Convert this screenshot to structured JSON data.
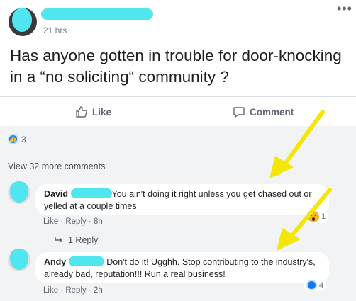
{
  "post": {
    "time": "21 hrs",
    "text": "Has anyone gotten in trouble for door-knocking in a “no soliciting“ community ?",
    "more_label": "•••"
  },
  "actions": {
    "like_label": "Like",
    "comment_label": "Comment"
  },
  "reactions": {
    "count": "3"
  },
  "comments_section": {
    "view_more": "View 32 more comments",
    "comments": [
      {
        "author": "David",
        "text": "You ain't doing it right unless you get chased out or yelled at a couple times",
        "like": "Like",
        "reply": "Reply",
        "time": "8h",
        "reaction_count": "1",
        "replies_label": "1 Reply"
      },
      {
        "author": "Andy",
        "text": "Don't do it! Ugghh. Stop contributing to the industry's, already bad, reputation!!! Run a real business!",
        "like": "Like",
        "reply": "Reply",
        "time": "2h",
        "reaction_count": "4"
      }
    ]
  },
  "colors": {
    "redaction": "#4fe6ef",
    "annotation_arrow": "#f5e60a"
  }
}
